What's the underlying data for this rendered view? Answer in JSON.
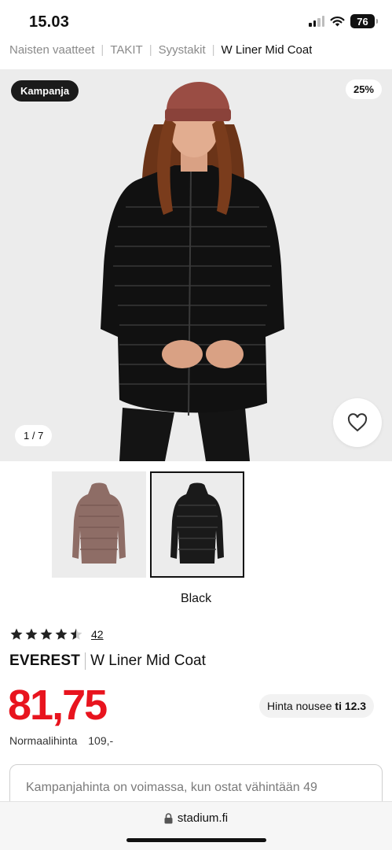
{
  "status_bar": {
    "time": "15.03",
    "battery": "76"
  },
  "breadcrumb": [
    "Naisten vaatteet",
    "TAKIT",
    "Syystakit",
    "W Liner Mid Coat"
  ],
  "hero": {
    "campaign_badge": "Kampanja",
    "discount_badge": "25%",
    "image_counter": "1 / 7"
  },
  "variants": {
    "selected_color": "Black",
    "swatches": [
      "mauve-coat",
      "black-coat"
    ]
  },
  "product": {
    "rating": 4.5,
    "review_count": "42",
    "brand": "EVEREST",
    "name": "W Liner Mid Coat",
    "price": "81,75",
    "price_note_prefix": "Hinta nousee",
    "price_note_date": "ti 12.3",
    "normal_price_label": "Normaalihinta",
    "normal_price_value": "109,-",
    "campaign_text": "Kampanjahinta on voimassa, kun ostat vähintään 49"
  },
  "browser": {
    "url": "stadium.fi"
  },
  "colors": {
    "price_red": "#e8141e",
    "badge_dark": "#1b1b1b",
    "hero_bg": "#ececec"
  }
}
